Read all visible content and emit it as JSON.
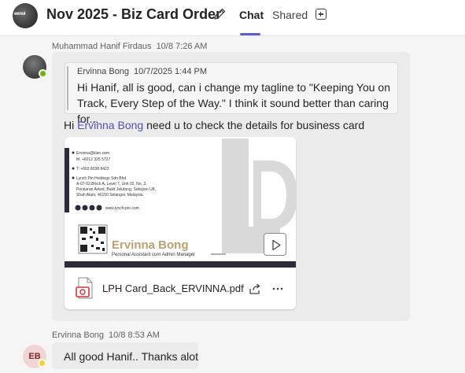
{
  "header": {
    "avatar_label": "eenol",
    "title": "Nov 2025 - Biz Card Order",
    "tabs": [
      {
        "label": "Chat",
        "active": true
      },
      {
        "label": "Shared",
        "active": false
      }
    ],
    "edit_icon": "pencil-icon",
    "add_tab_icon": "plus-square-icon",
    "accent_color": "#5b5fc7"
  },
  "messages": [
    {
      "author": "Muhammad Hanif Firdaus",
      "timestamp": "10/8 7:26 AM",
      "presence": "available",
      "quote": {
        "author": "Ervinna Bong",
        "timestamp": "10/7/2025 1:44 PM",
        "text": "Hi Hanif, all is good, can i change my tagline to \"Keeping You on Track, Every Step of the Way.\" I think it sound better than caring for..."
      },
      "text_prefix": "Hi ",
      "mention": "Ervinna Bong",
      "text_suffix": " need u to check the details for business card",
      "attachment": {
        "file_name": "LPH Card_Back_ERVINNA.pdf",
        "file_icon": "pdf-icon",
        "preview": {
          "email": "Ervinna@klan.com",
          "mobile": "M: +6012 325 5727",
          "tel": "T: +603 8038 8422",
          "company": "Lynch Pin Holdings Sdn Bhd",
          "address_1": "A-07-02,Block A, Level 7, Unit 02, No. 3,",
          "address_2": "Persiaran Arked, Bukit Jelutong, Seksyen U8,",
          "address_3": "Shah Alam, 40150 Selangor, Malaysia.",
          "website": "www.lynch-pin.com",
          "name": "Ervinna Bong",
          "role": "Personal Assistant cum Admin Manager",
          "name_color": "#b8a173",
          "band_color": "#2b2b3a"
        }
      }
    },
    {
      "author": "Ervinna Bong",
      "timestamp": "10/8 8:53 AM",
      "avatar_initials": "EB",
      "presence": "away",
      "text": "All good Hanif.. Thanks alot"
    }
  ]
}
